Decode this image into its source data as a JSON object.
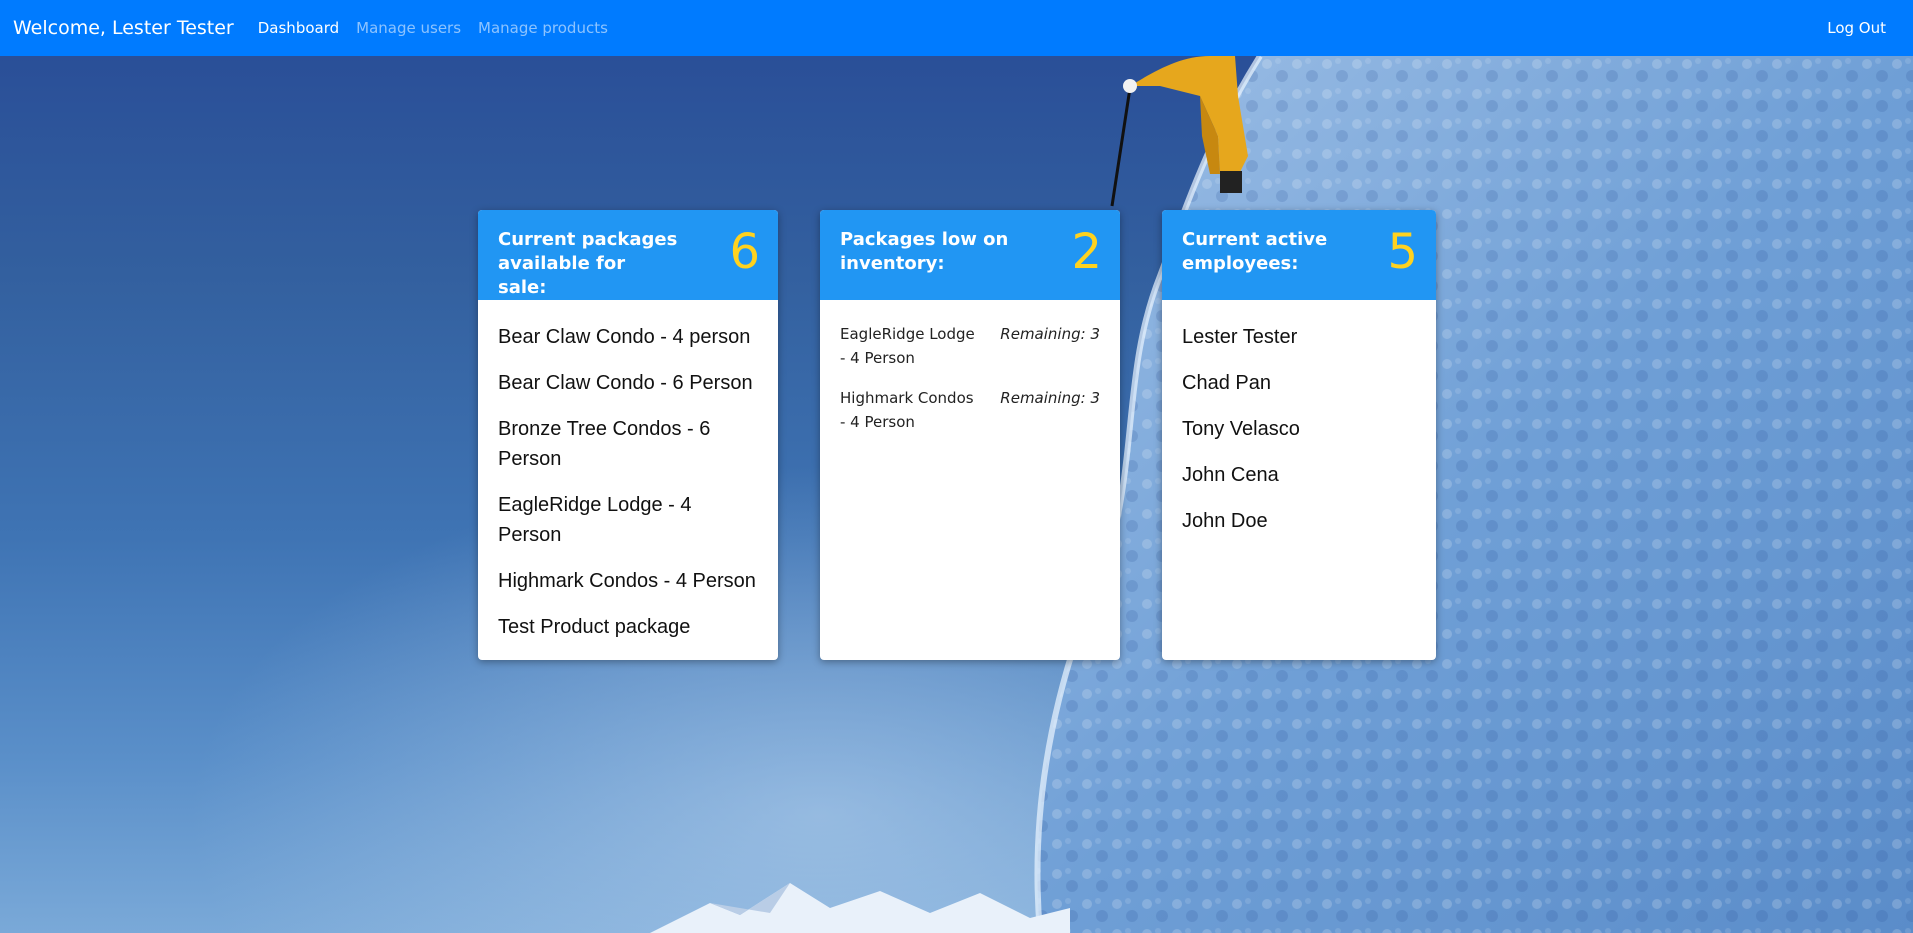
{
  "navbar": {
    "brand": "Welcome, Lester Tester",
    "links": [
      {
        "label": "Dashboard",
        "active": true
      },
      {
        "label": "Manage users",
        "active": false
      },
      {
        "label": "Manage products",
        "active": false
      }
    ],
    "logout_label": "Log Out",
    "color": "#007bff"
  },
  "cards": {
    "packages": {
      "title": "Current packages available for sale:",
      "count": "6",
      "items": [
        "Bear Claw Condo - 4 person",
        "Bear Claw Condo - 6 Person",
        "Bronze Tree Condos - 6 Person",
        "EagleRidge Lodge - 4 Person",
        "Highmark Condos - 4 Person",
        "Test Product package"
      ]
    },
    "low_inventory": {
      "title": "Packages low on inventory:",
      "count": "2",
      "items": [
        {
          "name": "EagleRidge Lodge - 4 Person",
          "remaining": "Remaining: 3"
        },
        {
          "name": "Highmark Condos - 4 Person",
          "remaining": "Remaining: 3"
        }
      ]
    },
    "employees": {
      "title": "Current active employees:",
      "count": "5",
      "items": [
        "Lester Tester",
        "Chad Pan",
        "Tony Velasco",
        "John Cena",
        "John Doe"
      ]
    },
    "header_color": "#2196f3",
    "count_color": "#ffd21f"
  }
}
